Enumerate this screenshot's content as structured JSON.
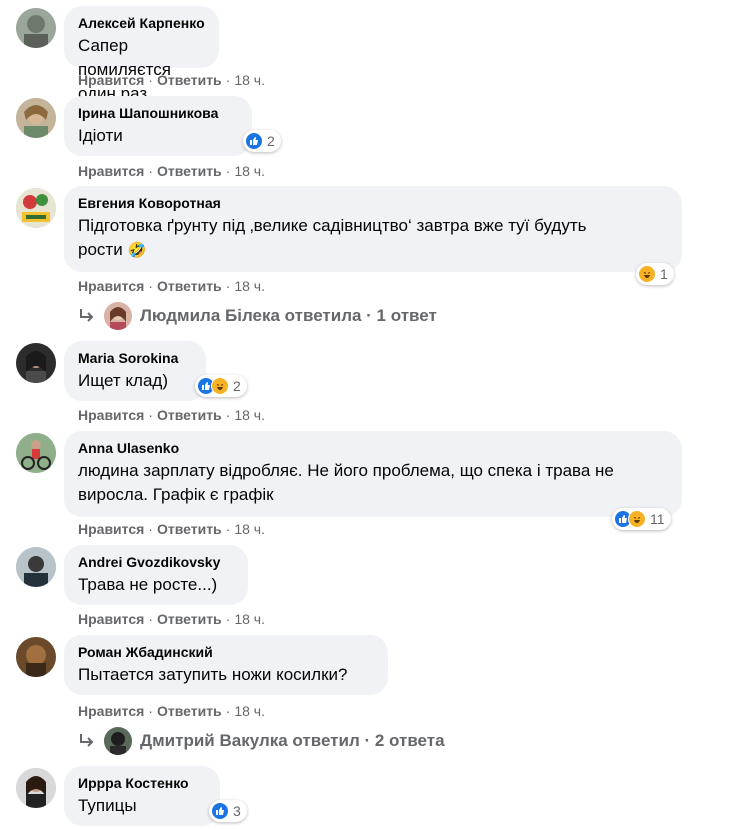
{
  "ui": {
    "like_label": "Нравится",
    "reply_label": "Ответить",
    "separator": "·"
  },
  "colors": {
    "bubble_bg": "#f0f2f5",
    "meta_text": "#65676b",
    "like_blue": "#1b74e4",
    "haha_yellow": "#f7b125"
  },
  "comments": [
    {
      "author": "Алексей Карпенко",
      "text": "Сапер помиляєтся один раз",
      "time": "18 ч."
    },
    {
      "author": "Ірина Шапошникова",
      "text": "Ідіоти",
      "time": "18 ч.",
      "reactions": "2",
      "reaction_icons": [
        "like-icon"
      ]
    },
    {
      "author": "Евгения Коворотная",
      "text_line1": "Підготовка ґрунту під ‚велике садівництво‘ завтра вже туї будуть",
      "text_line2": "рости",
      "text_emoji": "🤣",
      "time": "18 ч.",
      "reactions": "1",
      "reaction_icons": [
        "haha-icon"
      ],
      "replies": {
        "text": "Людмила Білека ответила · 1 ответ"
      }
    },
    {
      "author": "Maria Sorokina",
      "text": "Ищет клад)",
      "time": "18 ч.",
      "reactions": "2",
      "reaction_icons": [
        "like-icon",
        "haha-icon"
      ]
    },
    {
      "author": "Anna Ulasenko",
      "text_line1": "людина зарплату відробляє. Не його проблема, що спека і трава не",
      "text_line2": "виросла. Графік є графік",
      "time": "18 ч.",
      "reactions": "11",
      "reaction_icons": [
        "like-icon",
        "haha-icon"
      ]
    },
    {
      "author": "Andrei Gvozdikovsky",
      "text": "Трава не росте...)",
      "time": "18 ч."
    },
    {
      "author": "Роман Жбадинский",
      "text": "Пытается затупить ножи косилки?",
      "time": "18 ч.",
      "replies": {
        "text": "Дмитрий Вакулка ответил · 2 ответа"
      }
    },
    {
      "author": "Иррра Костенко",
      "text": "Тупицы",
      "reactions": "3",
      "reaction_icons": [
        "like-icon"
      ]
    }
  ]
}
